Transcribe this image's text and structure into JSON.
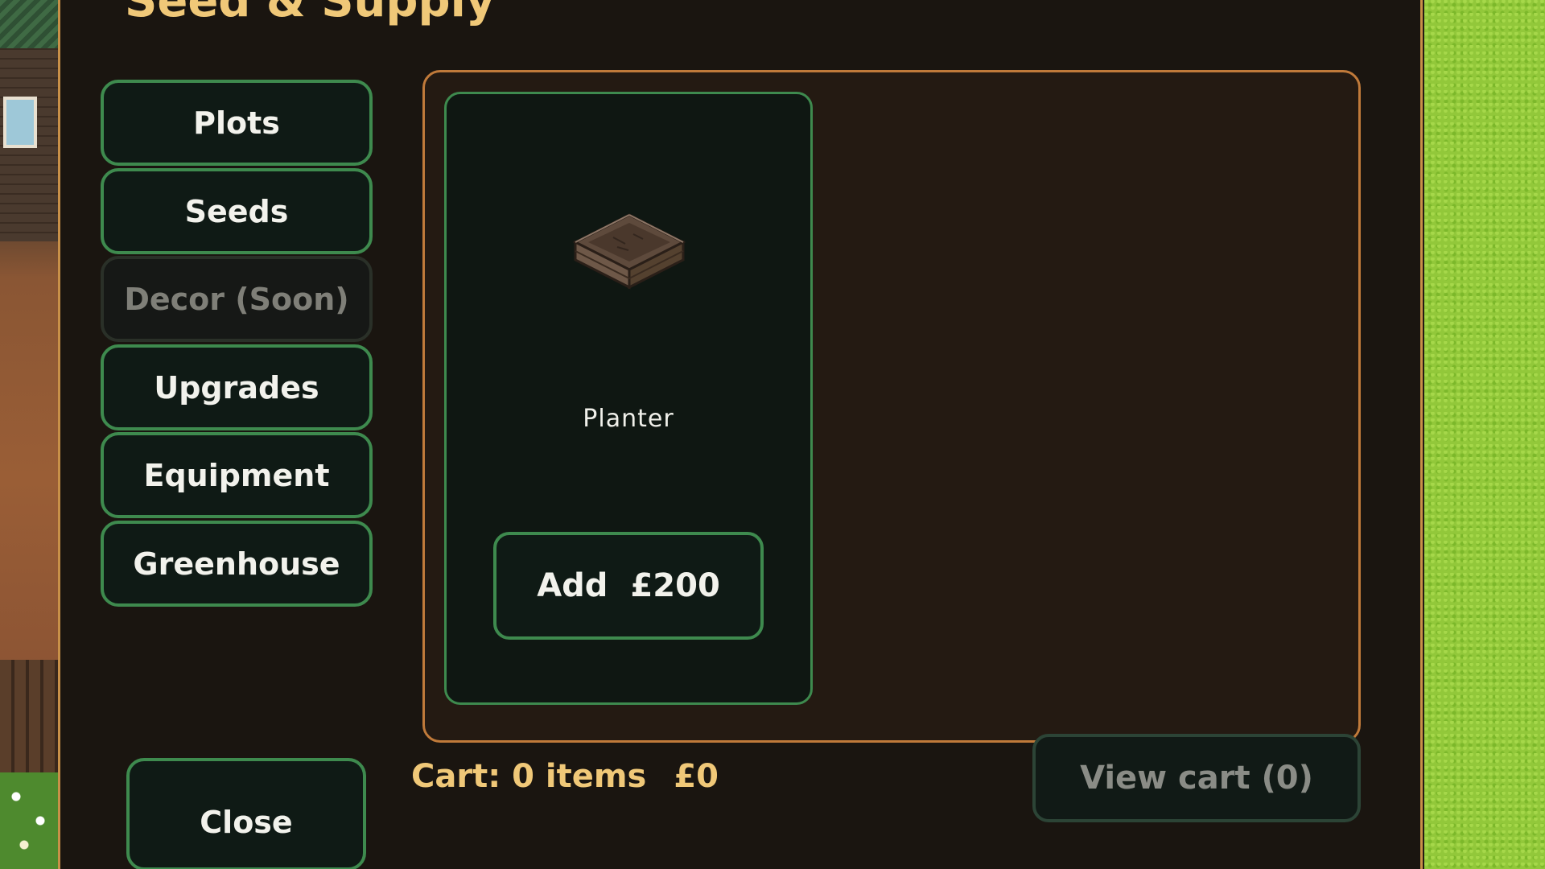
{
  "shop": {
    "title": "Seed & Supply",
    "categories": [
      {
        "label": "Plots",
        "enabled": true
      },
      {
        "label": "Seeds",
        "enabled": true
      },
      {
        "label": "Decor (Soon)",
        "enabled": false
      },
      {
        "label": "Upgrades",
        "enabled": true
      },
      {
        "label": "Equipment",
        "enabled": true
      },
      {
        "label": "Greenhouse",
        "enabled": true
      }
    ],
    "close_label": "Close",
    "items": [
      {
        "name": "Planter",
        "add_label": "Add",
        "price": "£200",
        "icon": "planter-icon"
      }
    ],
    "cart": {
      "summary_label": "Cart: 0 items",
      "total": "£0",
      "view_label": "View cart (0)"
    },
    "colors": {
      "accent_green": "#3e8a4e",
      "title_gold": "#f0c878",
      "panel_border": "#c89048"
    }
  }
}
